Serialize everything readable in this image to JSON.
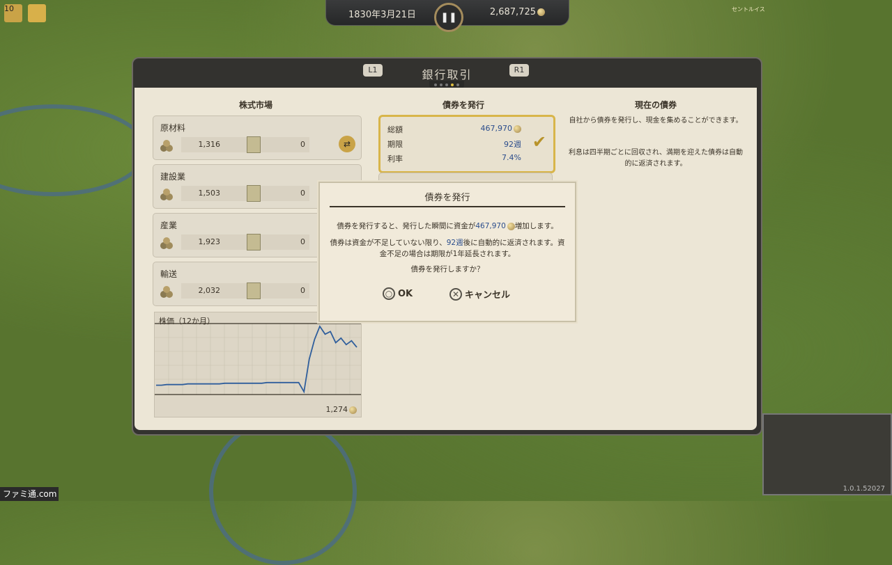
{
  "hud": {
    "date": "1830年3月21日",
    "money": "2,687,725",
    "level": "10",
    "city_labels": [
      "セントルイス"
    ]
  },
  "panel": {
    "title": "銀行取引",
    "left_button": "L1",
    "right_button": "R1"
  },
  "stock_market": {
    "title": "株式市場",
    "items": [
      {
        "name": "原材料",
        "value1": "1,316",
        "value2": "0"
      },
      {
        "name": "建設業",
        "value1": "1,503",
        "value2": "0"
      },
      {
        "name": "産業",
        "value1": "1,923",
        "value2": "0"
      },
      {
        "name": "輸送",
        "value1": "2,032",
        "value2": "0"
      }
    ]
  },
  "chart_data": {
    "type": "line",
    "title": "株価（12か月）",
    "min_label": "1,274",
    "series": [
      {
        "values": [
          10,
          10,
          11,
          11,
          11,
          11,
          12,
          12,
          12,
          12,
          12,
          12,
          12,
          13,
          13,
          13,
          13,
          13,
          13,
          13,
          13,
          14,
          14,
          14,
          14,
          14,
          14,
          14,
          0,
          50,
          80,
          100,
          88,
          92,
          75,
          82,
          72,
          78,
          68
        ]
      }
    ]
  },
  "issue_bonds": {
    "title": "債券を発行",
    "total_label": "総額",
    "total_value": "467,970",
    "term_label": "期限",
    "term_value": "92週",
    "rate_label": "利率",
    "rate_value": "7.4%"
  },
  "current_bonds": {
    "title": "現在の債券",
    "text1": "自社から債券を発行し、現金を集めることができます。",
    "text2": "利息は四半期ごとに回収され、満期を迎えた債券は自動的に返済されます。"
  },
  "dialog": {
    "title": "債券を発行",
    "line1_a": "債券を発行すると、発行した瞬間に資金が",
    "line1_amount": "467,970",
    "line1_b": "増加します。",
    "line2_a": "債券は資金が不足していない限り、",
    "line2_weeks": "92週",
    "line2_b": "後に自動的に返済されます。資金不足の場合は期限が1年延長されます。",
    "question": "債券を発行しますか？",
    "ok_label": "OK",
    "cancel_label": "キャンセル"
  },
  "footer": {
    "version": "1.0.1.52027",
    "watermark": "ファミ通.com"
  }
}
